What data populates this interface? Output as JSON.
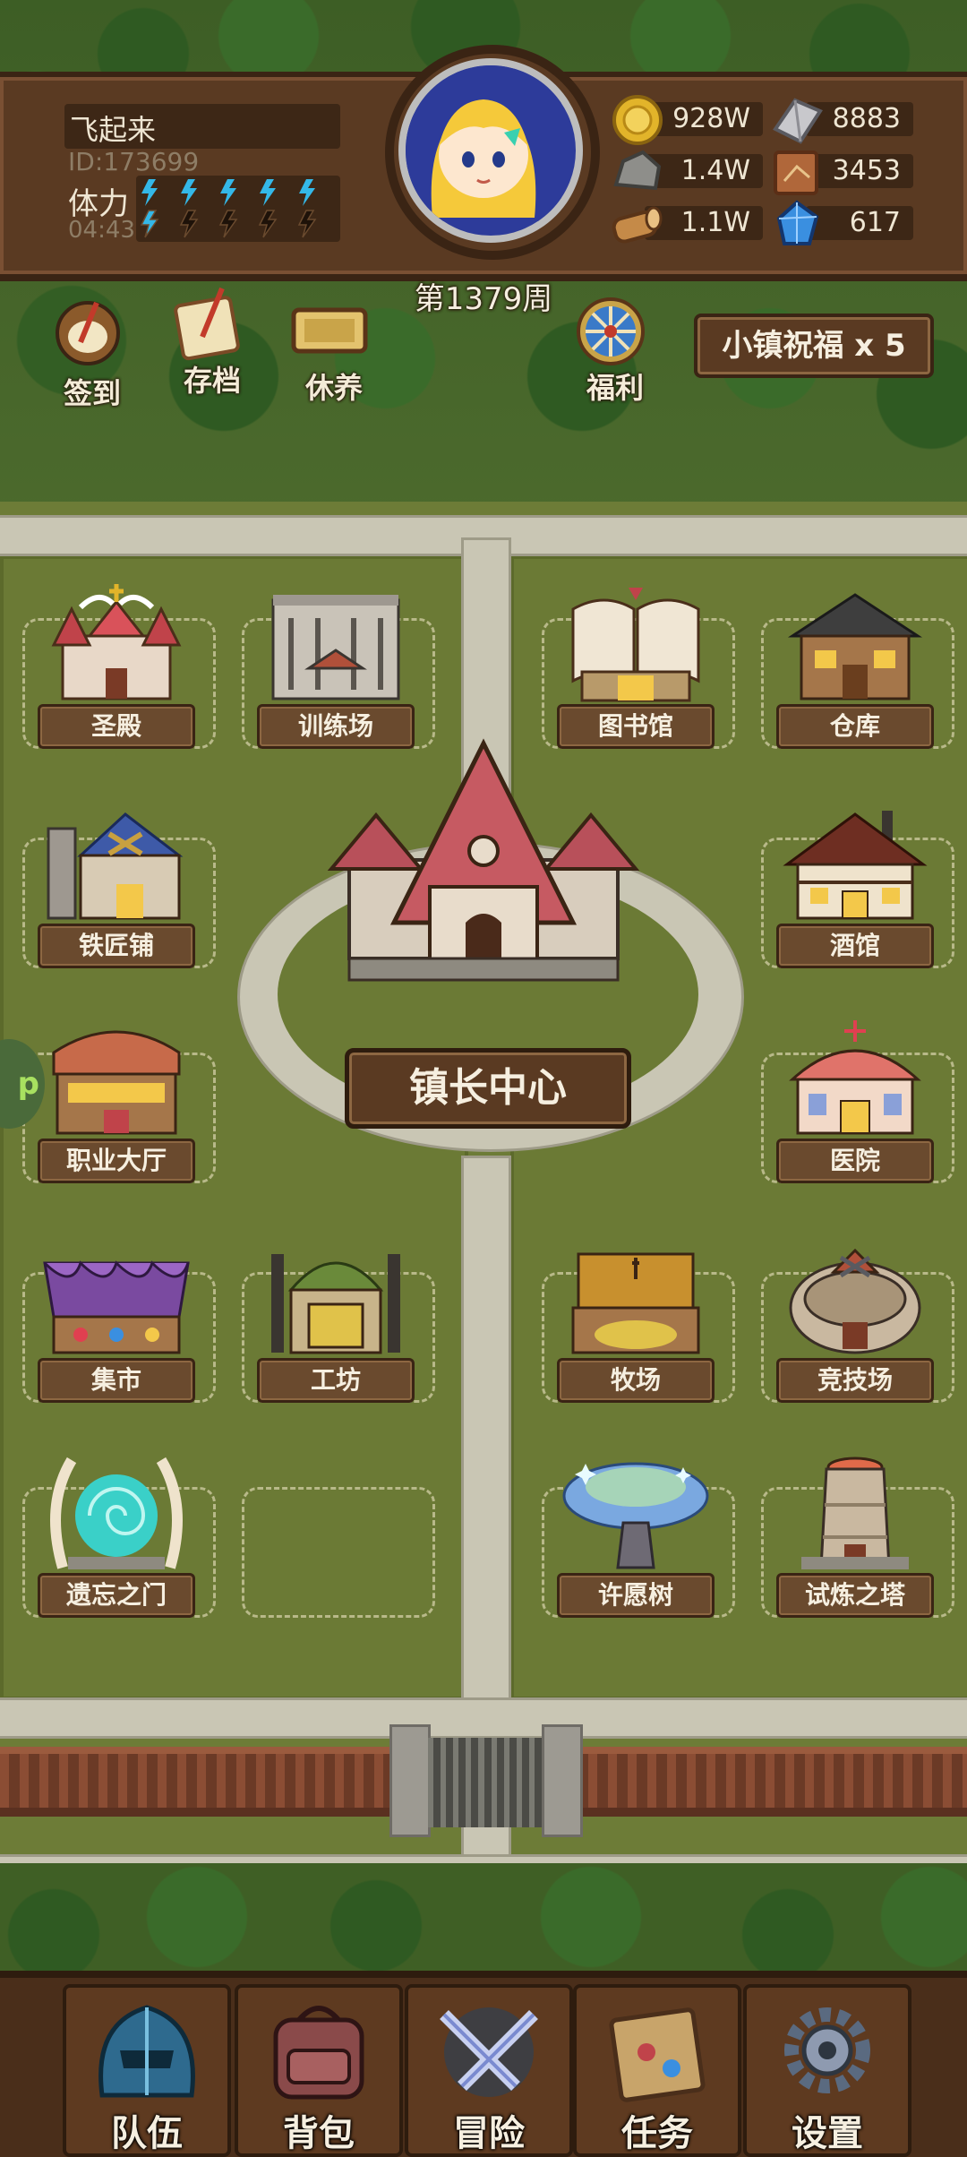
{
  "player": {
    "name": "飞起来",
    "id": "ID:173699",
    "stamina_label": "体力",
    "stamina_timer": "04:43",
    "stamina_full": 5,
    "stamina_max": 10,
    "week": "第1379周"
  },
  "resources": {
    "gold": "928W",
    "iron": "8883",
    "stone": "1.4W",
    "scroll": "3453",
    "wood": "1.1W",
    "crystal": "617"
  },
  "top_buttons": {
    "signin": "签到",
    "save": "存档",
    "rest": "休养",
    "welfare": "福利",
    "blessing": "小镇祝福 x 5"
  },
  "buildings": {
    "holy_hall": "圣殿",
    "training": "训练场",
    "library": "图书馆",
    "warehouse": "仓库",
    "blacksmith": "铁匠铺",
    "tavern": "酒馆",
    "mayor": "镇长中心",
    "job_hall": "职业大厅",
    "hospital": "医院",
    "market": "集市",
    "workshop": "工坊",
    "ranch": "牧场",
    "arena": "竞技场",
    "forgotten_gate": "遗忘之门",
    "wish_tree": "许愿树",
    "trial_tower": "试炼之塔"
  },
  "side_tab": "p",
  "nav": {
    "team": "队伍",
    "bag": "背包",
    "adventure": "冒险",
    "quest": "任务",
    "settings": "设置"
  },
  "colors": {
    "wood": "#5a3a22",
    "grass": "#6d7c37",
    "road": "#c9c6b4",
    "label": "#6a4a2e"
  }
}
